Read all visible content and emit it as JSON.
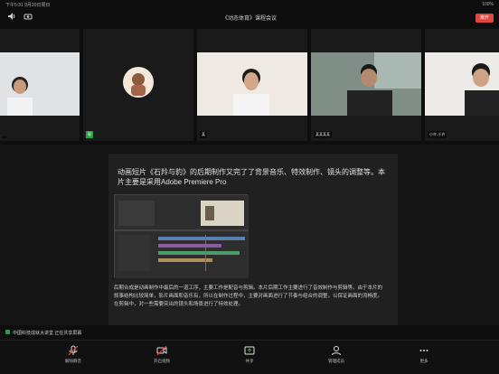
{
  "status": {
    "time": "下午5:31 9月20日周日",
    "battery": "100%"
  },
  "header": {
    "title": "《动态体育》课程会议",
    "leave_label": "离开"
  },
  "participants": [
    {
      "name": ""
    },
    {
      "name": "郭"
    },
    {
      "name": "某"
    },
    {
      "name": "某某某某"
    },
    {
      "name": "小许-小许"
    }
  ],
  "share": {
    "line1": "动画短片《石羚与豹》的后期制作又完了了背景音乐、特效制作、镜头的调整等。本",
    "line2": "片主要是采用Adobe Premiere Pro",
    "paragraph": "后期合成是动画制作中最后的一道工序，主要工作是配音与剪辑。本片后期工作主要进行了音效制作与剪辑等。由于本片的叙事结构比较简单，影片画面和音乐有，所以在制作过程中，主要对画面进行了节奏与组合的调整，以保证画面的流畅度。在剪辑中，对一些需要突出的镜头和场景进行了特效处理。"
  },
  "notice": "中国科技成就大讲堂 正在共享屏幕",
  "toolbar": [
    {
      "label": "解除静音",
      "icon": "mic-icon"
    },
    {
      "label": "开启视频",
      "icon": "video-icon"
    },
    {
      "label": "共享",
      "icon": "share-icon"
    },
    {
      "label": "管理成员",
      "icon": "participants-icon"
    },
    {
      "label": "更多",
      "icon": "more-icon"
    }
  ],
  "colors": {
    "accent": "#27a046",
    "leave": "#e1483d"
  }
}
